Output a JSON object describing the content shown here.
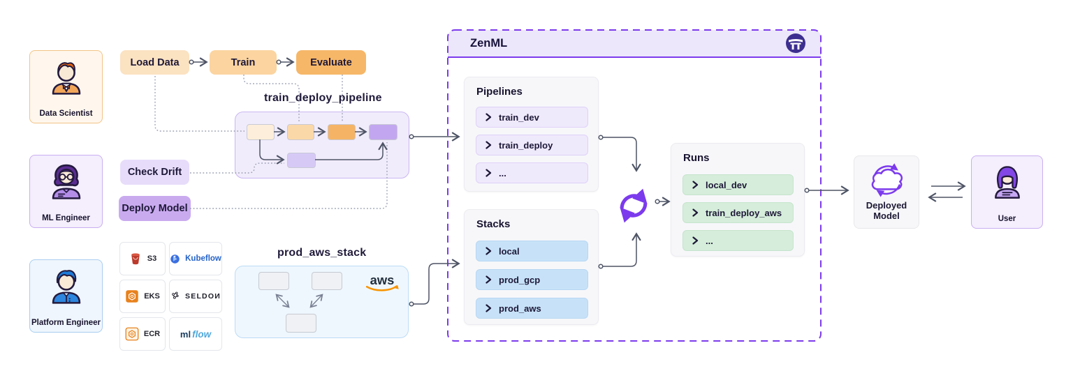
{
  "personas": {
    "data_scientist": {
      "label": "Data Scientist"
    },
    "ml_engineer": {
      "label": "ML Engineer"
    },
    "platform_engineer": {
      "label": "Platform Engineer"
    }
  },
  "steps": {
    "load_data": "Load Data",
    "train": "Train",
    "evaluate": "Evaluate",
    "check_drift": "Check Drift",
    "deploy_model": "Deploy Model"
  },
  "pipeline": {
    "title": "train_deploy_pipeline"
  },
  "aws_stack": {
    "title": "prod_aws_stack",
    "provider_logo": "aws"
  },
  "tools": {
    "s3": "S3",
    "kubeflow": "Kubeflow",
    "eks": "EKS",
    "seldon": "SELDOИ",
    "ecr": "ECR",
    "mlflow_prefix": "ml",
    "mlflow_suffix": "flow"
  },
  "zenml": {
    "title": "ZenML",
    "pipelines_panel": {
      "title": "Pipelines",
      "items": [
        "train_dev",
        "train_deploy",
        "..."
      ]
    },
    "stacks_panel": {
      "title": "Stacks",
      "items": [
        "local",
        "prod_gcp",
        "prod_aws"
      ]
    }
  },
  "runs_panel": {
    "title": "Runs",
    "items": [
      "local_dev",
      "train_deploy_aws",
      "..."
    ]
  },
  "deployed_model": {
    "label_line1": "Deployed",
    "label_line2": "Model"
  },
  "user": {
    "label": "User"
  },
  "colors": {
    "accent_purple": "#7C3AED",
    "orange_step": "#F6B768",
    "light_orange_step": "#FBE2C1",
    "mid_orange_step": "#FBD4A0",
    "purple_step_light": "#E7DDFA",
    "purple_step_mid": "#C9AAEF",
    "blue_pill": "#C7E2F8",
    "green_pill": "#D5EDDA",
    "aws_orange": "#F79400"
  }
}
